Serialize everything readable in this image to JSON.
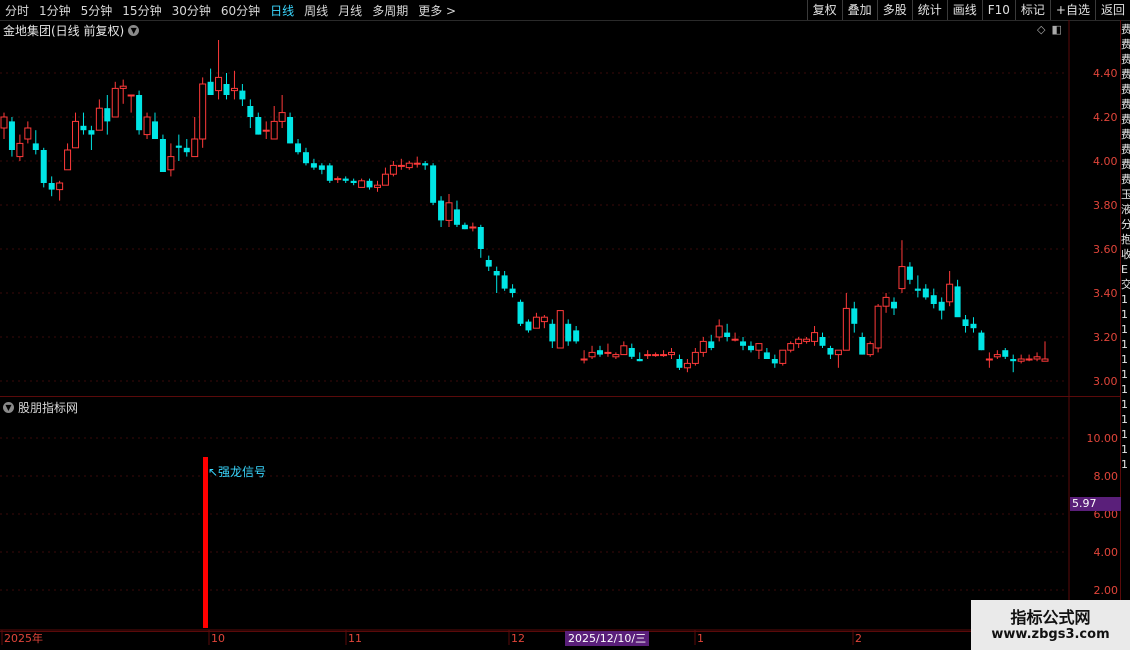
{
  "toolbar": {
    "tabs": [
      "分时",
      "1分钟",
      "5分钟",
      "15分钟",
      "30分钟",
      "60分钟",
      "日线",
      "周线",
      "月线",
      "多周期",
      "更多"
    ],
    "active_tab": "日线",
    "right_buttons": [
      "复权",
      "叠加",
      "多股",
      "统计",
      "画线",
      "F10",
      "标记",
      "+自选",
      "返回"
    ]
  },
  "chart": {
    "title": "金地集团(日线 前复权)",
    "indicator_title": "股朋指标网",
    "signal_label": "↖强龙信号",
    "price_tag": "5.97",
    "cursor_date": "2025/12/10/三",
    "date_labels": [
      "2025年",
      "10",
      "11",
      "12",
      "1",
      "2"
    ],
    "price_axis": [
      "4.40",
      "4.20",
      "4.00",
      "3.80",
      "3.60",
      "3.40",
      "3.20",
      "3.00"
    ],
    "indicator_axis": [
      "10.00",
      "8.00",
      "6.00",
      "4.00",
      "2.00"
    ],
    "side_strip_text": [
      "费",
      "费",
      "费",
      "费",
      "费",
      "费",
      "费",
      "费",
      "费",
      "费",
      "费",
      "玉",
      "液",
      "分",
      "抱",
      "收",
      "E",
      "交",
      "1",
      "1",
      "1",
      "1",
      "1",
      "1",
      "1",
      "1",
      "1",
      "1",
      "1",
      "1"
    ]
  },
  "watermark": {
    "line1": "指标公式网",
    "line2": "www.zbgs3.com"
  },
  "colors": {
    "up": "#ff3a3a",
    "down": "#00e5e5",
    "axis_text": "#e0453a",
    "active_tab": "#3ad7ff",
    "signal_bar": "#ff0000",
    "signal_text": "#3ad7ff",
    "panel_border": "#5a0a0a",
    "tag_bg": "#5a1f7a"
  },
  "chart_data": {
    "type": "candlestick",
    "price_range": [
      2.95,
      4.55
    ],
    "ohlc": [
      [
        4.15,
        4.22,
        4.1,
        4.2
      ],
      [
        4.18,
        4.2,
        4.02,
        4.05
      ],
      [
        4.02,
        4.12,
        4.0,
        4.08
      ],
      [
        4.1,
        4.18,
        4.08,
        4.15
      ],
      [
        4.08,
        4.14,
        4.03,
        4.05
      ],
      [
        4.05,
        4.06,
        3.88,
        3.9
      ],
      [
        3.9,
        3.93,
        3.84,
        3.87
      ],
      [
        3.87,
        3.91,
        3.82,
        3.9
      ],
      [
        3.96,
        4.08,
        3.96,
        4.05
      ],
      [
        4.06,
        4.22,
        4.06,
        4.18
      ],
      [
        4.16,
        4.22,
        4.12,
        4.14
      ],
      [
        4.14,
        4.16,
        4.05,
        4.12
      ],
      [
        4.14,
        4.28,
        4.14,
        4.24
      ],
      [
        4.24,
        4.3,
        4.12,
        4.18
      ],
      [
        4.2,
        4.36,
        4.2,
        4.33
      ],
      [
        4.33,
        4.37,
        4.26,
        4.34
      ],
      [
        4.3,
        4.3,
        4.22,
        4.3
      ],
      [
        4.3,
        4.32,
        4.12,
        4.14
      ],
      [
        4.12,
        4.22,
        4.1,
        4.2
      ],
      [
        4.18,
        4.22,
        4.12,
        4.1
      ],
      [
        4.1,
        4.12,
        3.95,
        3.95
      ],
      [
        3.96,
        4.08,
        3.93,
        4.02
      ],
      [
        4.07,
        4.12,
        4.0,
        4.06
      ],
      [
        4.06,
        4.1,
        4.02,
        4.04
      ],
      [
        4.02,
        4.2,
        4.02,
        4.1
      ],
      [
        4.1,
        4.38,
        4.06,
        4.35
      ],
      [
        4.36,
        4.42,
        4.3,
        4.3
      ],
      [
        4.32,
        4.55,
        4.28,
        4.38
      ],
      [
        4.35,
        4.4,
        4.28,
        4.3
      ],
      [
        4.32,
        4.41,
        4.28,
        4.33
      ],
      [
        4.32,
        4.35,
        4.25,
        4.28
      ],
      [
        4.25,
        4.28,
        4.15,
        4.2
      ],
      [
        4.2,
        4.22,
        4.12,
        4.12
      ],
      [
        4.14,
        4.18,
        4.1,
        4.14
      ],
      [
        4.1,
        4.25,
        4.1,
        4.18
      ],
      [
        4.18,
        4.3,
        4.15,
        4.22
      ],
      [
        4.2,
        4.22,
        4.08,
        4.08
      ],
      [
        4.08,
        4.1,
        4.03,
        4.04
      ],
      [
        4.04,
        4.06,
        3.98,
        3.99
      ],
      [
        3.99,
        4.01,
        3.96,
        3.97
      ],
      [
        3.98,
        3.99,
        3.94,
        3.96
      ],
      [
        3.98,
        3.99,
        3.9,
        3.91
      ],
      [
        3.92,
        3.93,
        3.9,
        3.92
      ],
      [
        3.92,
        3.93,
        3.9,
        3.91
      ],
      [
        3.91,
        3.92,
        3.89,
        3.9
      ],
      [
        3.88,
        3.92,
        3.88,
        3.91
      ],
      [
        3.91,
        3.92,
        3.87,
        3.88
      ],
      [
        3.88,
        3.91,
        3.86,
        3.89
      ],
      [
        3.89,
        3.97,
        3.89,
        3.94
      ],
      [
        3.94,
        4.0,
        3.93,
        3.98
      ],
      [
        3.98,
        4.01,
        3.96,
        3.98
      ],
      [
        3.97,
        4.0,
        3.96,
        3.99
      ],
      [
        3.99,
        4.02,
        3.97,
        3.99
      ],
      [
        3.99,
        4.0,
        3.96,
        3.98
      ],
      [
        3.98,
        3.99,
        3.8,
        3.81
      ],
      [
        3.82,
        3.84,
        3.7,
        3.73
      ],
      [
        3.73,
        3.85,
        3.7,
        3.81
      ],
      [
        3.78,
        3.82,
        3.7,
        3.71
      ],
      [
        3.71,
        3.72,
        3.69,
        3.69
      ],
      [
        3.7,
        3.72,
        3.68,
        3.7
      ],
      [
        3.7,
        3.71,
        3.56,
        3.6
      ],
      [
        3.55,
        3.57,
        3.5,
        3.52
      ],
      [
        3.5,
        3.52,
        3.4,
        3.48
      ],
      [
        3.48,
        3.5,
        3.41,
        3.42
      ],
      [
        3.42,
        3.44,
        3.38,
        3.4
      ],
      [
        3.36,
        3.37,
        3.25,
        3.26
      ],
      [
        3.27,
        3.28,
        3.22,
        3.23
      ],
      [
        3.24,
        3.31,
        3.24,
        3.29
      ],
      [
        3.27,
        3.3,
        3.24,
        3.29
      ],
      [
        3.26,
        3.28,
        3.15,
        3.18
      ],
      [
        3.15,
        3.25,
        3.15,
        3.32
      ],
      [
        3.26,
        3.28,
        3.16,
        3.18
      ],
      [
        3.23,
        3.25,
        3.17,
        3.18
      ],
      [
        3.1,
        3.14,
        3.08,
        3.1
      ],
      [
        3.11,
        3.16,
        3.1,
        3.13
      ],
      [
        3.14,
        3.16,
        3.11,
        3.12
      ],
      [
        3.13,
        3.17,
        3.11,
        3.13
      ],
      [
        3.11,
        3.13,
        3.1,
        3.12
      ],
      [
        3.12,
        3.18,
        3.12,
        3.16
      ],
      [
        3.15,
        3.17,
        3.1,
        3.11
      ],
      [
        3.1,
        3.13,
        3.09,
        3.09
      ],
      [
        3.12,
        3.14,
        3.1,
        3.12
      ],
      [
        3.12,
        3.13,
        3.11,
        3.12
      ],
      [
        3.12,
        3.14,
        3.11,
        3.12
      ],
      [
        3.12,
        3.15,
        3.1,
        3.13
      ],
      [
        3.1,
        3.12,
        3.05,
        3.06
      ],
      [
        3.06,
        3.1,
        3.04,
        3.08
      ],
      [
        3.08,
        3.15,
        3.07,
        3.13
      ],
      [
        3.13,
        3.2,
        3.11,
        3.18
      ],
      [
        3.18,
        3.21,
        3.14,
        3.15
      ],
      [
        3.2,
        3.28,
        3.18,
        3.25
      ],
      [
        3.22,
        3.26,
        3.18,
        3.2
      ],
      [
        3.19,
        3.22,
        3.18,
        3.19
      ],
      [
        3.18,
        3.2,
        3.14,
        3.16
      ],
      [
        3.16,
        3.18,
        3.13,
        3.14
      ],
      [
        3.14,
        3.17,
        3.1,
        3.17
      ],
      [
        3.13,
        3.15,
        3.1,
        3.1
      ],
      [
        3.1,
        3.12,
        3.06,
        3.08
      ],
      [
        3.08,
        3.14,
        3.07,
        3.14
      ],
      [
        3.14,
        3.18,
        3.13,
        3.17
      ],
      [
        3.17,
        3.2,
        3.15,
        3.19
      ],
      [
        3.18,
        3.2,
        3.17,
        3.19
      ],
      [
        3.18,
        3.25,
        3.16,
        3.22
      ],
      [
        3.2,
        3.22,
        3.15,
        3.16
      ],
      [
        3.15,
        3.16,
        3.1,
        3.12
      ],
      [
        3.12,
        3.14,
        3.06,
        3.14
      ],
      [
        3.14,
        3.4,
        3.14,
        3.33
      ],
      [
        3.33,
        3.36,
        3.22,
        3.26
      ],
      [
        3.2,
        3.22,
        3.12,
        3.12
      ],
      [
        3.12,
        3.18,
        3.11,
        3.17
      ],
      [
        3.15,
        3.35,
        3.13,
        3.34
      ],
      [
        3.34,
        3.4,
        3.31,
        3.38
      ],
      [
        3.36,
        3.38,
        3.3,
        3.33
      ],
      [
        3.42,
        3.64,
        3.4,
        3.52
      ],
      [
        3.52,
        3.54,
        3.44,
        3.46
      ],
      [
        3.42,
        3.48,
        3.38,
        3.41
      ],
      [
        3.42,
        3.44,
        3.37,
        3.38
      ],
      [
        3.39,
        3.42,
        3.33,
        3.35
      ],
      [
        3.36,
        3.38,
        3.28,
        3.32
      ],
      [
        3.36,
        3.5,
        3.34,
        3.44
      ],
      [
        3.43,
        3.46,
        3.3,
        3.29
      ],
      [
        3.28,
        3.3,
        3.22,
        3.25
      ],
      [
        3.26,
        3.29,
        3.22,
        3.24
      ],
      [
        3.22,
        3.23,
        3.14,
        3.14
      ],
      [
        3.1,
        3.13,
        3.06,
        3.1
      ],
      [
        3.11,
        3.14,
        3.1,
        3.12
      ],
      [
        3.14,
        3.15,
        3.1,
        3.11
      ],
      [
        3.1,
        3.12,
        3.04,
        3.09
      ],
      [
        3.09,
        3.12,
        3.08,
        3.1
      ],
      [
        3.1,
        3.12,
        3.09,
        3.1
      ],
      [
        3.1,
        3.13,
        3.09,
        3.11
      ],
      [
        3.09,
        3.18,
        3.09,
        3.1
      ]
    ],
    "indicator": {
      "axis_range": [
        0,
        12
      ],
      "signal_value": 9.0
    }
  }
}
